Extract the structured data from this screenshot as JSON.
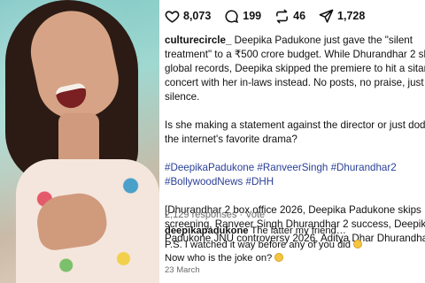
{
  "photo": {
    "subject": "laughing-woman-photo"
  },
  "actions": {
    "likes": "8,073",
    "comments": "199",
    "reposts": "46",
    "shares": "1,728"
  },
  "caption": {
    "username": "culturecircle_",
    "line1": " Deepika Padukone just gave the \"silent",
    "line2": "treatment\" to a ₹500 crore budget. While Dhurandhar 2 sh",
    "line3": "global records, Deepika skipped the premiere to hit a sitar",
    "line4": "concert with her in-laws instead. No posts, no praise, just",
    "line5": "silence.",
    "line6": "Is she making a statement against the director or just dodg",
    "line7": "the internet's favorite drama?",
    "hashtags1": "#DeepikaPadukone #RanveerSingh #Dhurandhar2",
    "hashtags2": "#BollywoodNews #DHH",
    "line8": "[Dhurandhar 2 box office 2026, Deepika Padukone skips",
    "line9": "screening, Ranveer Singh Dhurandhar 2 success, Deepika",
    "line10": "Padukone JNU controversy 2026, Aditya Dhar Dhurandhar"
  },
  "responses": "2,129 responses · Vote",
  "comment": {
    "username": "deepikapadukone",
    "line1": " The latter my friend…",
    "line2": "P.S. I watched it way before any of you did",
    "line3": "Now who is the joke on?"
  },
  "date": "23 March"
}
